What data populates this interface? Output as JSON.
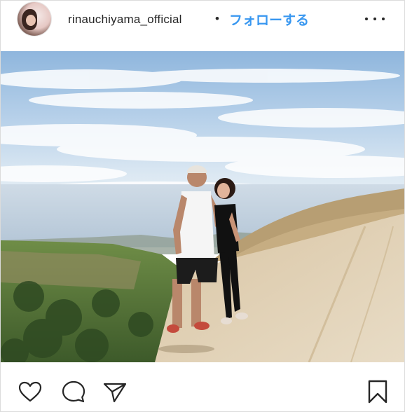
{
  "post": {
    "username": "rinauchiyama_official",
    "separator": "•",
    "follow_label": "フォローする"
  },
  "icons": {
    "avatar": "avatar",
    "more": "more-options-icon",
    "like": "heart-icon",
    "comment": "comment-bubble-icon",
    "share": "paper-plane-icon",
    "save": "bookmark-icon"
  },
  "colors": {
    "follow_blue": "#3897f0",
    "text": "#262626",
    "border": "#dbdbdb"
  }
}
